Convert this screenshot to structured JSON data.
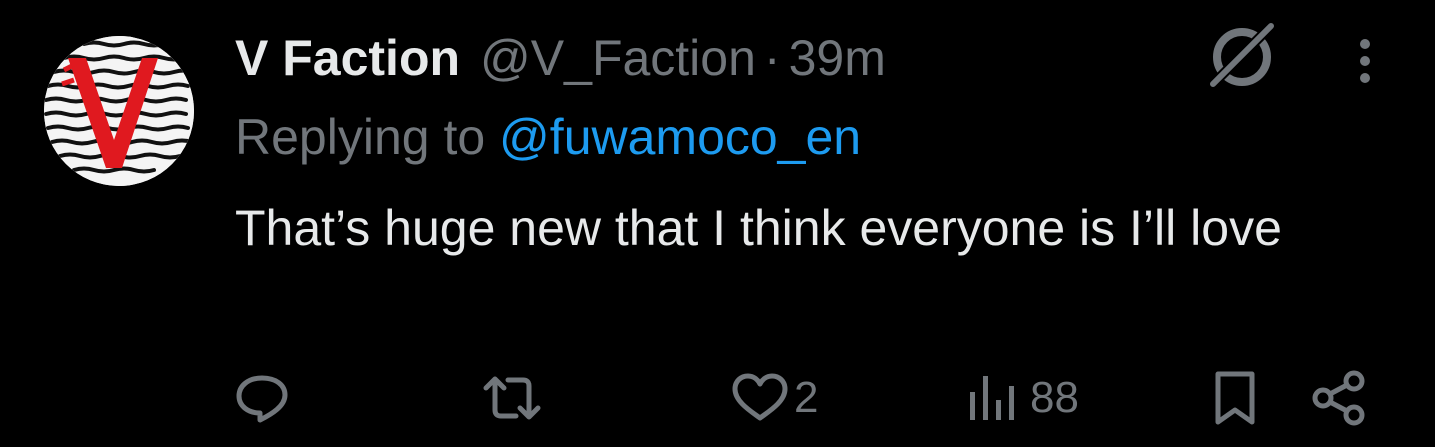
{
  "tweet": {
    "display_name": "V Faction",
    "handle": "@V_Faction",
    "separator": "·",
    "time": "39m",
    "replying_prefix": "Replying to ",
    "replying_handle": "@fuwamoco_en",
    "text": "That’s huge new that I think everyone is I’ll love"
  },
  "avatar": {
    "letter": "V",
    "accent_color": "#e0191f",
    "background_color": "#f4f4f4",
    "line_color": "#111111"
  },
  "actions": {
    "reply": {
      "icon": "reply-icon",
      "count": ""
    },
    "retweet": {
      "icon": "retweet-icon",
      "count": ""
    },
    "like": {
      "icon": "heart-icon",
      "count": "2"
    },
    "views": {
      "icon": "views-icon",
      "count": "88"
    },
    "bookmark": {
      "icon": "bookmark-icon"
    },
    "share": {
      "icon": "share-icon"
    }
  },
  "colors": {
    "background": "#000000",
    "primary_text": "#e7e9ea",
    "secondary_text": "#71767b",
    "link": "#1d9bf0"
  }
}
